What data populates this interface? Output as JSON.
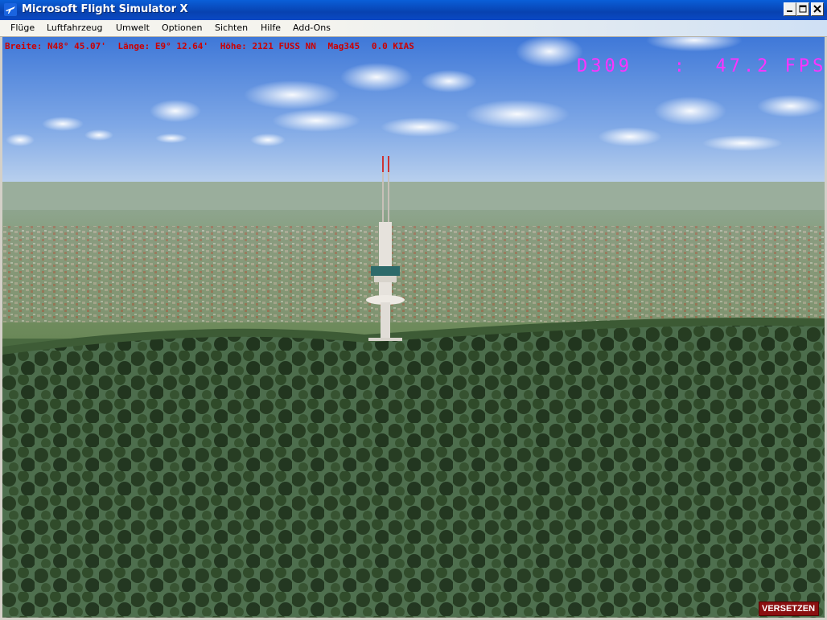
{
  "window": {
    "title": "Microsoft Flight Simulator X",
    "icon": "airplane-icon",
    "controls": [
      "minimize-icon",
      "maximize-icon",
      "close-icon"
    ]
  },
  "menu": [
    {
      "label": "Flüge"
    },
    {
      "label": "Luftfahrzeug"
    },
    {
      "label": "Umwelt"
    },
    {
      "label": "Optionen"
    },
    {
      "label": "Sichten"
    },
    {
      "label": "Hilfe"
    },
    {
      "label": "Add-Ons"
    }
  ],
  "hud": {
    "latitude": "Breite: N48° 45.07'",
    "longitude": "Länge: E9° 12.64'",
    "altitude": "Höhe: 2121 FUSS NN",
    "heading": "Mag345",
    "speed": "0.0 KIAS",
    "text_color": "#cc0000"
  },
  "fps": {
    "text": "D309   :  47.2 FPS",
    "color": "#ff33ff"
  },
  "slew_badge": {
    "label": "VERSETZEN",
    "color": "#8a1010"
  },
  "colors": {
    "titlebar": "#0842b0",
    "sky": "#5a8fe0",
    "forest": "#2f4a2a"
  }
}
